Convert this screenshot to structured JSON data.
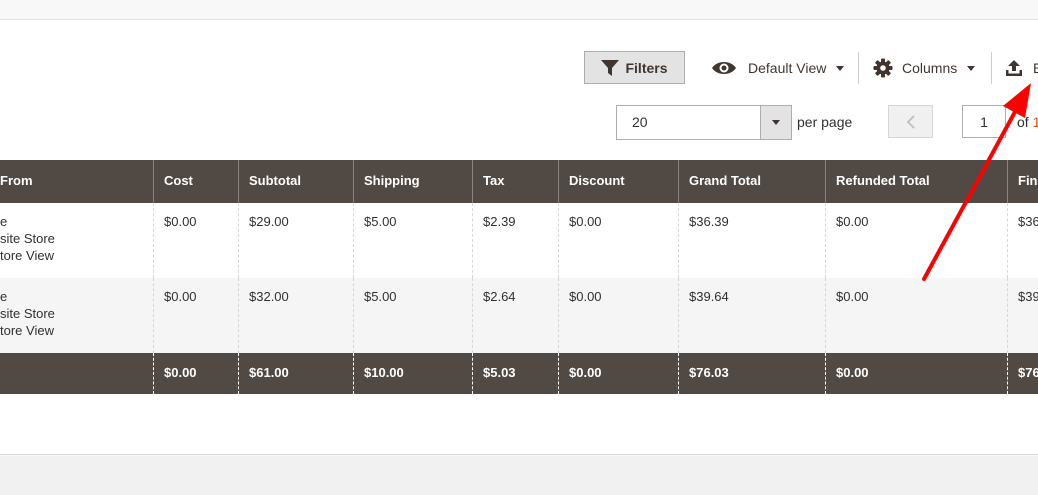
{
  "toolbar": {
    "filters_label": "Filters",
    "view_label": "Default View",
    "columns_label": "Columns",
    "export_label": "E"
  },
  "pagination": {
    "per_page_value": "20",
    "per_page_label": "per page",
    "current_page": "1",
    "of_label": "of ",
    "total_pages": "1"
  },
  "grid": {
    "headers": {
      "purchased_from": "From",
      "cost": "Cost",
      "subtotal": "Subtotal",
      "shipping": "Shipping",
      "tax": "Tax",
      "discount": "Discount",
      "grand_total": "Grand Total",
      "refunded_total": "Refunded Total",
      "final": "Fina"
    },
    "rows": [
      {
        "purchased_from": [
          "e",
          "site Store",
          "tore View"
        ],
        "cost": "$0.00",
        "subtotal": "$29.00",
        "shipping": "$5.00",
        "tax": "$2.39",
        "discount": "$0.00",
        "grand_total": "$36.39",
        "refunded_total": "$0.00",
        "final": "$36"
      },
      {
        "purchased_from": [
          "e",
          "site Store",
          "tore View"
        ],
        "cost": "$0.00",
        "subtotal": "$32.00",
        "shipping": "$5.00",
        "tax": "$2.64",
        "discount": "$0.00",
        "grand_total": "$39.64",
        "refunded_total": "$0.00",
        "final": "$39"
      }
    ],
    "totals": {
      "cost": "$0.00",
      "subtotal": "$61.00",
      "shipping": "$10.00",
      "tax": "$5.03",
      "discount": "$0.00",
      "grand_total": "$76.03",
      "refunded_total": "$0.00",
      "final": "$76"
    }
  },
  "icons": {
    "filters": "funnel-icon",
    "view": "eye-icon",
    "columns": "gear-icon",
    "export": "upload-icon",
    "prev": "chevron-left-icon"
  },
  "colors": {
    "grid_header_bg": "#514943",
    "accent": "#eb5202",
    "annotation_arrow": "#ff0000"
  }
}
